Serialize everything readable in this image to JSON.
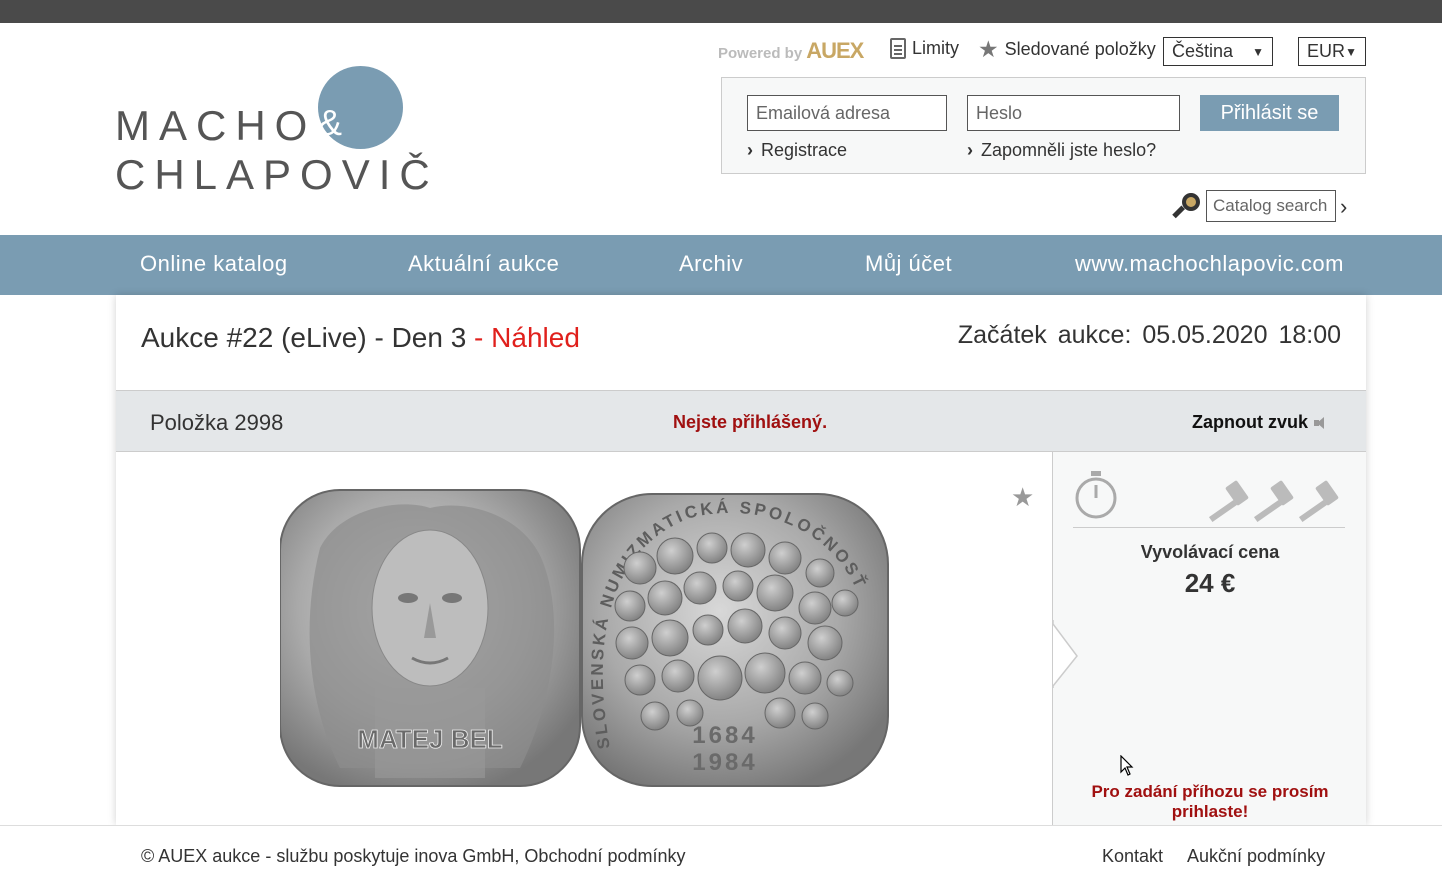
{
  "logo": {
    "line1": "MACHO",
    "amp": "&",
    "line2": "CHLAPOVIČ"
  },
  "header": {
    "powered_by": "Powered by",
    "powered_brand": "AUEX",
    "limits_label": "Limity",
    "watched_label": "Sledované položky",
    "language": "Čeština",
    "currency": "EUR"
  },
  "login": {
    "email_placeholder": "Emailová adresa",
    "password_placeholder": "Heslo",
    "submit_label": "Přihlásit se",
    "register_label": "Registrace",
    "forgot_label": "Zapomněli jste heslo?"
  },
  "search": {
    "placeholder": "Catalog search"
  },
  "nav": {
    "items": [
      {
        "label": "Online katalog"
      },
      {
        "label": "Aktuální aukce"
      },
      {
        "label": "Archiv"
      },
      {
        "label": "Můj účet"
      },
      {
        "label": "www.machochlapovic.com"
      }
    ]
  },
  "auction": {
    "title": "Aukce #22 (eLive) - Den 3",
    "preview_suffix": " - Náhled",
    "start_label": "Začátek aukce:",
    "start_date": "05.05.2020",
    "start_time": "18:00"
  },
  "item": {
    "number_label": "Položka 2998",
    "not_logged_in": "Nejste přihlášený.",
    "sound_label": "Zapnout zvuk",
    "coin_left_text": "MATEJ BEL",
    "coin_right_legend": "SLOVENSKÁ NUMIZMATICKÁ SPOLOČNOSŤ",
    "coin_right_year1": "1684",
    "coin_right_year2": "1984"
  },
  "bid": {
    "start_price_label": "Vyvolávací cena",
    "start_price": "24 €",
    "login_note": "Pro zadání příhozu se prosím prihlaste!"
  },
  "footer": {
    "copyright": "© AUEX aukce - službu poskytuje inova GmbH, Obchodní podmínky",
    "contact": "Kontakt",
    "terms": "Aukční podmínky"
  },
  "colors": {
    "accent": "#7a9cb2",
    "alert": "#a01010",
    "preview_red": "#e0201c",
    "brand_gold": "#c8a764"
  }
}
